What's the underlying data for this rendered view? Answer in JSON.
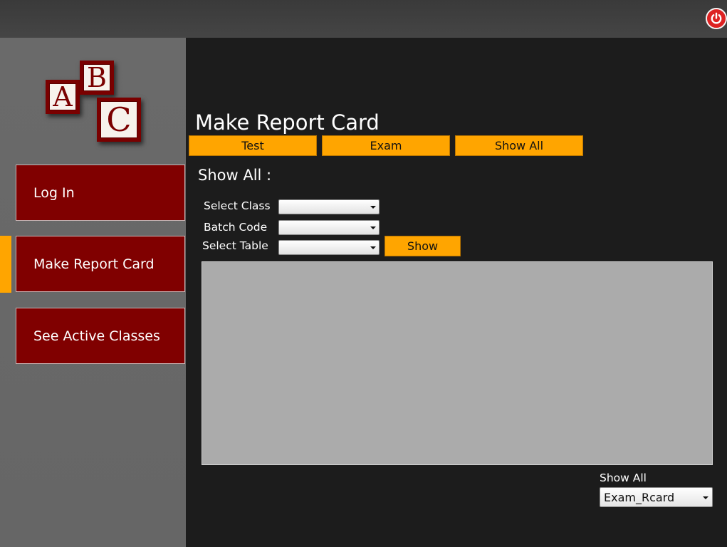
{
  "window": {
    "power_icon": "power-icon"
  },
  "logo": {
    "letters": [
      "A",
      "B",
      "C"
    ]
  },
  "sidebar": {
    "items": [
      {
        "label": "Log In"
      },
      {
        "label": "Make Report Card",
        "active": true
      },
      {
        "label": "See Active Classes"
      }
    ]
  },
  "main": {
    "title": "Make Report Card",
    "tabs": [
      {
        "label": "Test"
      },
      {
        "label": "Exam"
      },
      {
        "label": "Show All"
      }
    ],
    "section_title": "Show All :",
    "fields": [
      {
        "label": "Select Class",
        "value": ""
      },
      {
        "label": "Batch Code",
        "value": ""
      },
      {
        "label": "Select Table",
        "value": ""
      }
    ],
    "show_button": "Show",
    "bottom": {
      "label": "Show All",
      "select_value": "Exam_Rcard"
    }
  },
  "colors": {
    "accent": "#ffa500",
    "nav_button": "#800000",
    "background": "#1c1c1c",
    "sidebar": "#686868",
    "grid": "#ababab"
  }
}
